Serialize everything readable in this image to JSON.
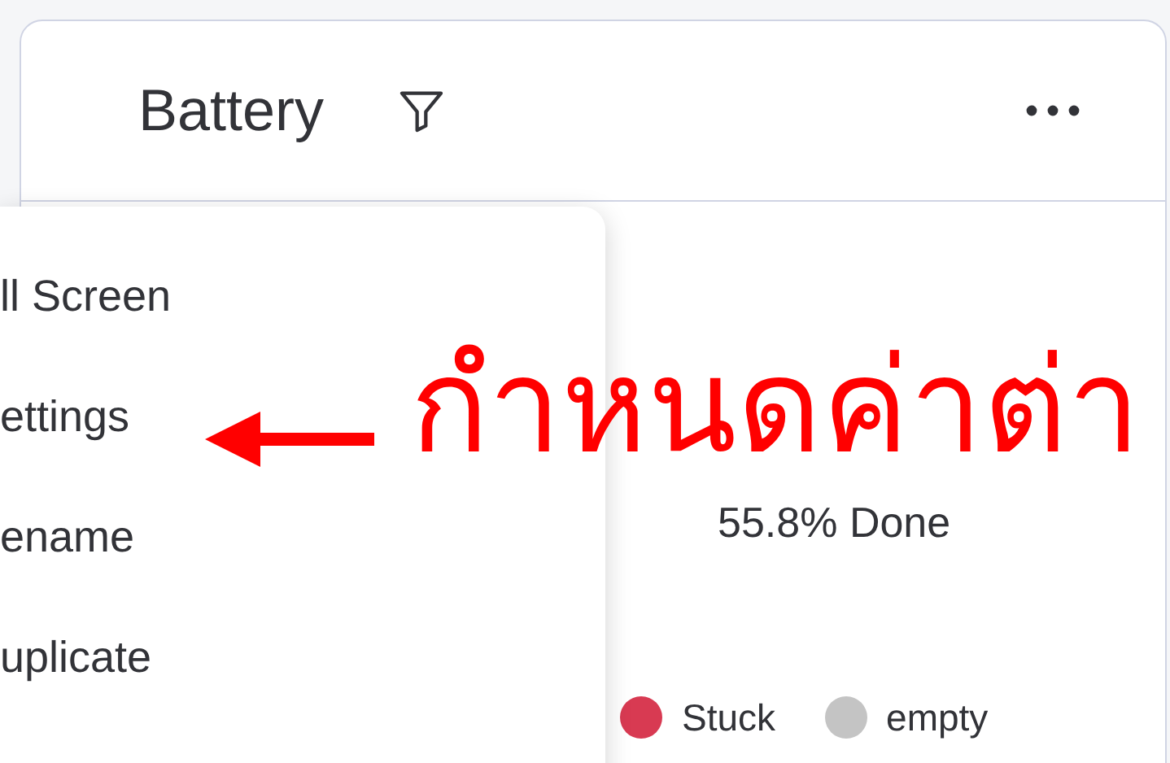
{
  "widget": {
    "title": "Battery",
    "progress_text": "55.8% Done",
    "legend": [
      {
        "label": "Stuck",
        "color": "#d83a52"
      },
      {
        "label": "empty",
        "color": "#c4c4c4"
      }
    ]
  },
  "menu": {
    "items": [
      {
        "label": "ll Screen"
      },
      {
        "label": "ettings"
      },
      {
        "label": "ename"
      },
      {
        "label": "uplicate"
      }
    ]
  },
  "annotation": {
    "text": "กำหนดค่าต่า"
  }
}
